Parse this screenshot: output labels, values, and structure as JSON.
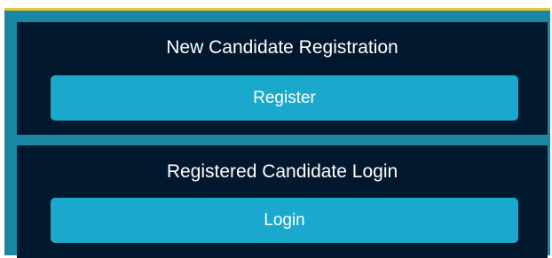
{
  "colors": {
    "frame": "#1a87a3",
    "frame_accent": "#e8c23a",
    "panel": "#02182f",
    "button": "#1aa9cc",
    "text": "#ffffff"
  },
  "register_section": {
    "title": "New Candidate Registration",
    "button_label": "Register"
  },
  "login_section": {
    "title": "Registered Candidate Login",
    "button_label": "Login"
  }
}
